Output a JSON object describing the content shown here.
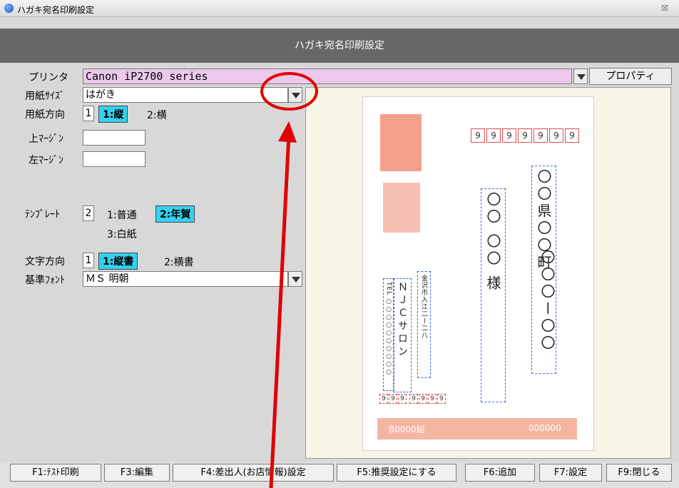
{
  "window": {
    "title": "ハガキ宛名印刷設定",
    "close": "☒"
  },
  "header": {
    "title": "ハガキ宛名印刷設定"
  },
  "printer": {
    "label": "プリンタ",
    "value": "Canon iP2700 series",
    "properties_label": "プロパティ"
  },
  "paper_size": {
    "label": "用紙ｻｲｽﾞ",
    "value": "はがき"
  },
  "orientation": {
    "label": "用紙方向",
    "value": "1",
    "opt1": "1:縦",
    "opt2": "2:横"
  },
  "margins": {
    "top_label": "上ﾏｰｼﾞﾝ",
    "left_label": "左ﾏｰｼﾞﾝ"
  },
  "template": {
    "label": "ﾃﾝﾌﾟﾚｰﾄ",
    "value": "2",
    "opt1": "1:普通",
    "opt2": "2:年賀",
    "opt3": "3:白紙"
  },
  "text_direction": {
    "label": "文字方向",
    "value": "1",
    "opt1": "1:縦書",
    "opt2": "2:横書"
  },
  "font": {
    "label": "基準ﾌｫﾝﾄ",
    "value": "ＭＳ 明朝"
  },
  "preview": {
    "zip": [
      "9",
      "9",
      "9",
      "9",
      "9",
      "9",
      "9"
    ],
    "address1": "〇〇県〇〇町",
    "address2": "〇〇〇ー〇〇",
    "name": "〇〇 〇〇 様",
    "sender_name": "ＮＪＣサロン",
    "sender_address": "金沢市入江二ー二八",
    "sender_tel": "TEL ○○○○○○○○○○",
    "sender_zip": [
      "9",
      "9",
      "9",
      "9",
      "9",
      "9",
      "9"
    ],
    "lottery_code": "B0000組",
    "lottery_number": "000000"
  },
  "footer": {
    "f1": "F1:ﾃｽﾄ印刷",
    "f3": "F3:編集",
    "f4": "F4:差出人(お店情報)設定",
    "f5": "F5:推奨設定にする",
    "f6": "F6:追加",
    "f7": "F7:設定",
    "f9": "F9:閉じる"
  },
  "colors": {
    "selected": "#33d2f0",
    "printer_bg": "#ecc9ec",
    "annotation": "#e10000"
  }
}
